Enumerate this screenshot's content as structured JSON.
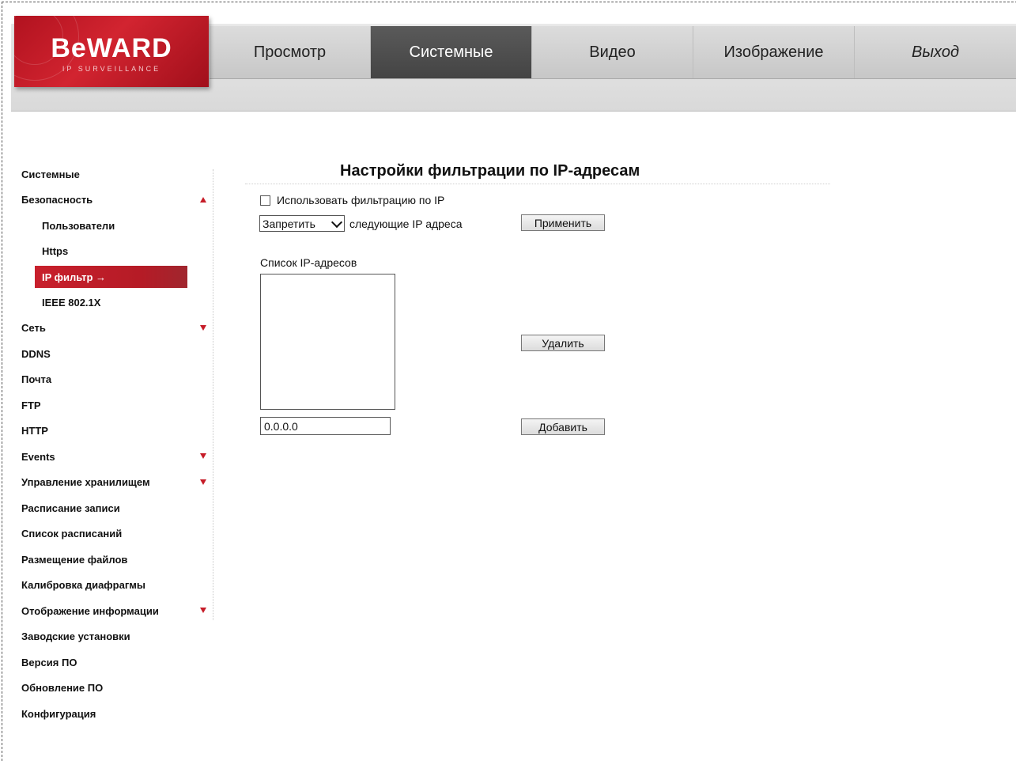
{
  "brand": {
    "logo_text": "BeWARD",
    "logo_sub": "IP SURVEILLANCE"
  },
  "nav": {
    "tabs": [
      {
        "label": "Просмотр"
      },
      {
        "label": "Системные",
        "active": true
      },
      {
        "label": "Видео"
      },
      {
        "label": "Изображение"
      },
      {
        "label": "Выход"
      }
    ]
  },
  "sidebar": {
    "items": [
      {
        "label": "Системные"
      },
      {
        "label": "Безопасность",
        "arrow": "up"
      },
      {
        "label": "Пользователи",
        "sub": true
      },
      {
        "label": "Https",
        "sub": true
      },
      {
        "label": "IP фильтр →",
        "sub": true,
        "active": true
      },
      {
        "label": "IEEE 802.1X",
        "sub": true
      },
      {
        "label": "Сеть",
        "arrow": "down"
      },
      {
        "label": "DDNS"
      },
      {
        "label": "Почта"
      },
      {
        "label": "FTP"
      },
      {
        "label": "HTTP"
      },
      {
        "label": "Events",
        "arrow": "down"
      },
      {
        "label": "Управление хранилищем",
        "arrow": "down"
      },
      {
        "label": "Расписание записи"
      },
      {
        "label": "Список расписаний"
      },
      {
        "label": "Размещение файлов"
      },
      {
        "label": "Калибровка диафрагмы"
      },
      {
        "label": "Отображение информации",
        "arrow": "down"
      },
      {
        "label": "Заводские установки"
      },
      {
        "label": "Версия ПО"
      },
      {
        "label": "Обновление ПО"
      },
      {
        "label": "Конфигурация"
      }
    ]
  },
  "main": {
    "title": "Настройки фильтрации по IP-адресам",
    "use_filter_label": "Использовать фильтрацию по IP",
    "use_filter_checked": false,
    "mode_select_value": "Запретить",
    "mode_suffix": "следующие IP адреса",
    "apply_button": "Применить",
    "list_label": "Список IP-адресов",
    "delete_button": "Удалить",
    "ip_input_value": "0.0.0.0",
    "add_button": "Добавить"
  },
  "colors": {
    "accent": "#c61c28",
    "nav_active": "#4a4a4a"
  }
}
